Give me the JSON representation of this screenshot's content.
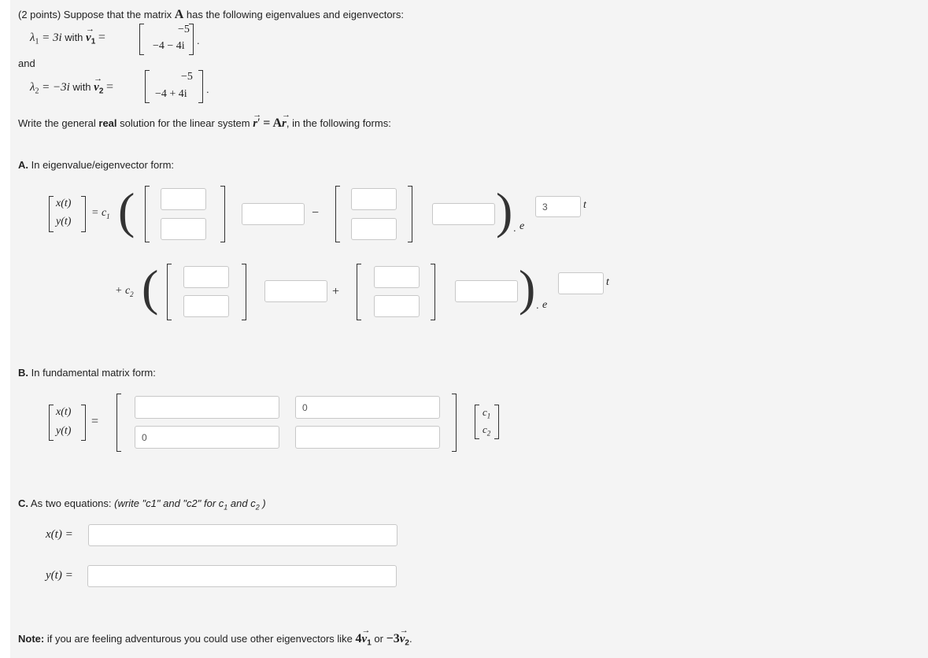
{
  "problem": {
    "intro_prefix": "(2 points) Suppose that the matrix",
    "matrix_symbol": "A",
    "intro_suffix": "has the following eigenvalues and eigenvectors:",
    "lambda1_lhs": "λ",
    "lambda1_sub": "1",
    "lambda1_value": "= 3i",
    "with": "with",
    "v1_sub": "1",
    "v1_entries": [
      "−5",
      "−4 − 4i"
    ],
    "and": "and",
    "lambda2_sub": "2",
    "lambda2_value": "= −3i",
    "v2_sub": "2",
    "v2_entries": [
      "−5",
      "−4 + 4i"
    ],
    "write_prefix": "Write the general",
    "write_bold": "real",
    "write_mid": "solution for the linear system",
    "system_eq": "= A",
    "write_suffix": ", in the following forms:"
  },
  "part_a": {
    "label": "A.",
    "text": "In eigenvalue/eigenvector form:",
    "lhs": [
      "x(t)",
      "y(t)"
    ],
    "eq_c1": "= c",
    "c1_sub": "1",
    "minus": "−",
    "plus_c2": "+ c",
    "c2_sub": "2",
    "plus": "+",
    "e": "e",
    "t": "t",
    "row1_exp_value": "3",
    "row2_exp_value": ""
  },
  "part_b": {
    "label": "B.",
    "text": "In fundamental matrix form:",
    "lhs": [
      "x(t)",
      "y(t)"
    ],
    "eq": "=",
    "matrix_values": [
      "",
      "0",
      "0",
      ""
    ],
    "c_vec": [
      "c",
      "c"
    ],
    "c_subs": [
      "1",
      "2"
    ]
  },
  "part_c": {
    "label": "C.",
    "text": "As two equations:",
    "hint": "(write \"c1\" and \"c2\" for c",
    "hint_and": "and c",
    "hint_close": ")",
    "x_label": "x(t) =",
    "y_label": "y(t) =",
    "x_value": "",
    "y_value": ""
  },
  "note": {
    "label": "Note:",
    "text": "if you are feeling adventurous you could use other eigenvectors like",
    "ex1": "4",
    "or": "or",
    "ex2": "−3",
    "period": "."
  }
}
